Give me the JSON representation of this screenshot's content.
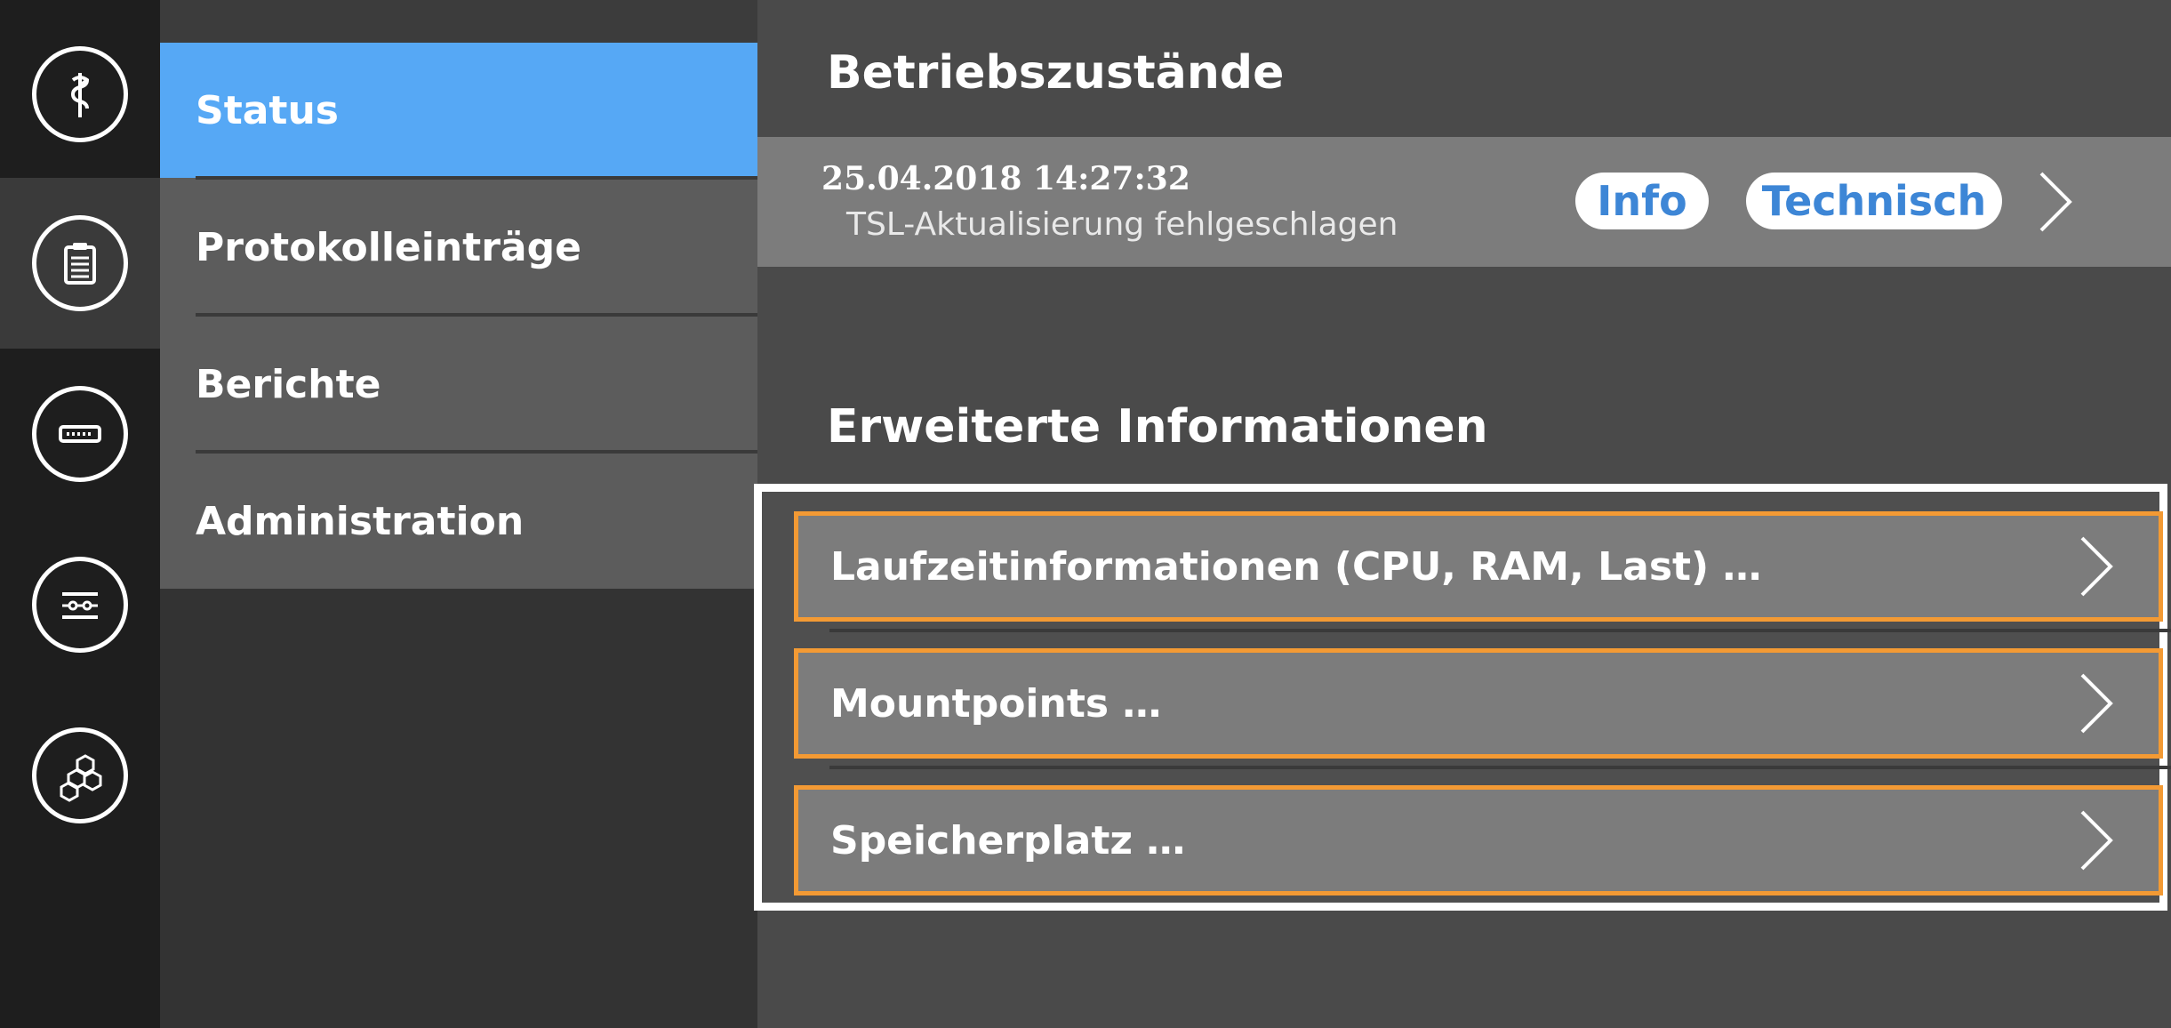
{
  "rail": {
    "items": [
      {
        "icon": "caduceus-icon",
        "active": false
      },
      {
        "icon": "clipboard-icon",
        "active": true
      },
      {
        "icon": "network-switch-icon",
        "active": false
      },
      {
        "icon": "settings-sliders-icon",
        "active": false
      },
      {
        "icon": "hexagons-icon",
        "active": false
      }
    ]
  },
  "submenu": {
    "items": [
      {
        "label": "Status",
        "active": true
      },
      {
        "label": "Protokolleinträge",
        "active": false
      },
      {
        "label": "Berichte",
        "active": false
      },
      {
        "label": "Administration",
        "active": false
      }
    ]
  },
  "main": {
    "operating_states": {
      "title": "Betriebszustände",
      "entry": {
        "timestamp": "25.04.2018 14:27:32",
        "message": "TSL-Aktualisierung fehlgeschlagen",
        "badges": [
          "Info",
          "Technisch"
        ]
      }
    },
    "extended_info": {
      "title": "Erweiterte Informationen",
      "items": [
        "Laufzeitinformationen (CPU, RAM, Last) …",
        "Mountpoints …",
        "Speicherplatz …"
      ]
    }
  },
  "colors": {
    "accent_blue": "#56a8f5",
    "highlight_orange": "#f39a34",
    "badge_text": "#3d86d6"
  }
}
